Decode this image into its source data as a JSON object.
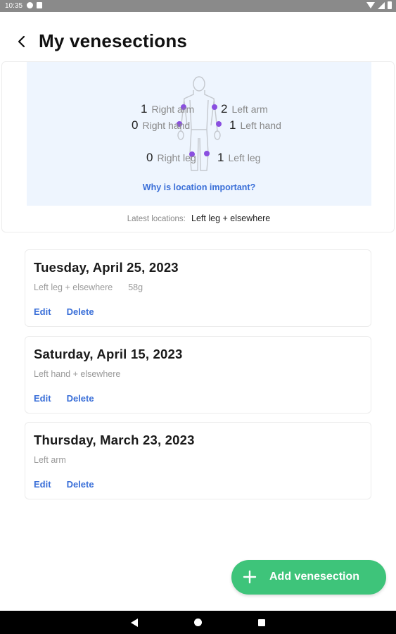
{
  "status_bar": {
    "time": "10:35"
  },
  "header": {
    "title": "My venesections"
  },
  "location_summary": {
    "right_arm": {
      "count": "1",
      "label": "Right arm"
    },
    "left_arm": {
      "count": "2",
      "label": "Left arm"
    },
    "right_hand": {
      "count": "0",
      "label": "Right hand"
    },
    "left_hand": {
      "count": "1",
      "label": "Left hand"
    },
    "right_leg": {
      "count": "0",
      "label": "Right leg"
    },
    "left_leg": {
      "count": "1",
      "label": "Left leg"
    },
    "why_link": "Why is location important?",
    "latest_label": "Latest locations:",
    "latest_value": "Left leg + elsewhere",
    "marker_color": "#8a4fe0"
  },
  "entries": [
    {
      "date": "Tuesday, April 25, 2023",
      "location": "Left leg + elsewhere",
      "amount": "58g",
      "edit": "Edit",
      "delete": "Delete"
    },
    {
      "date": "Saturday, April 15, 2023",
      "location": "Left hand + elsewhere",
      "amount": "",
      "edit": "Edit",
      "delete": "Delete"
    },
    {
      "date": "Thursday, March 23, 2023",
      "location": "Left arm",
      "amount": "",
      "edit": "Edit",
      "delete": "Delete"
    }
  ],
  "fab": {
    "label": "Add venesection",
    "color": "#3ec47a"
  },
  "icons": [
    "back-arrow-icon",
    "body-figure-icon",
    "plus-icon",
    "nav-back-icon",
    "nav-home-icon",
    "nav-recents-icon"
  ]
}
